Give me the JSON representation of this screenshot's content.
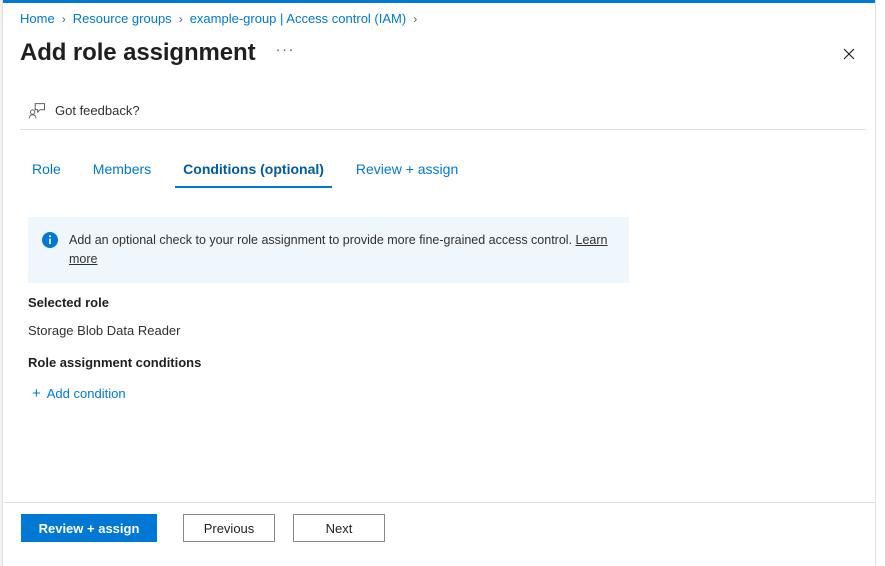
{
  "window": {
    "accent_color": "#0078d4"
  },
  "breadcrumb": {
    "separator": "›",
    "items": [
      {
        "label": "Home"
      },
      {
        "label": "Resource groups"
      },
      {
        "label": "example-group | Access control (IAM)"
      }
    ]
  },
  "header": {
    "title": "Add role assignment",
    "ellipsis": "···",
    "close_label": "✕",
    "close_icon": "close-icon"
  },
  "feedback": {
    "label": "Got feedback?",
    "icon": "feedback-person-icon"
  },
  "tabs": [
    {
      "label": "Role",
      "active": false
    },
    {
      "label": "Members",
      "active": false
    },
    {
      "label": "Conditions (optional)",
      "active": true
    },
    {
      "label": "Review + assign",
      "active": false
    }
  ],
  "info_banner": {
    "icon": "info-icon",
    "text": "Add an optional check to your role assignment to provide more fine-grained access control. ",
    "link_text": "Learn more",
    "background_color": "#eff6fc"
  },
  "content": {
    "selected_role_heading": "Selected role",
    "selected_role_value": "Storage Blob Data Reader",
    "conditions_heading": "Role assignment conditions",
    "add_condition_label": "Add condition",
    "add_condition_plus": "+"
  },
  "footer": {
    "primary_label": "Review + assign",
    "previous_label": "Previous",
    "next_label": "Next"
  }
}
